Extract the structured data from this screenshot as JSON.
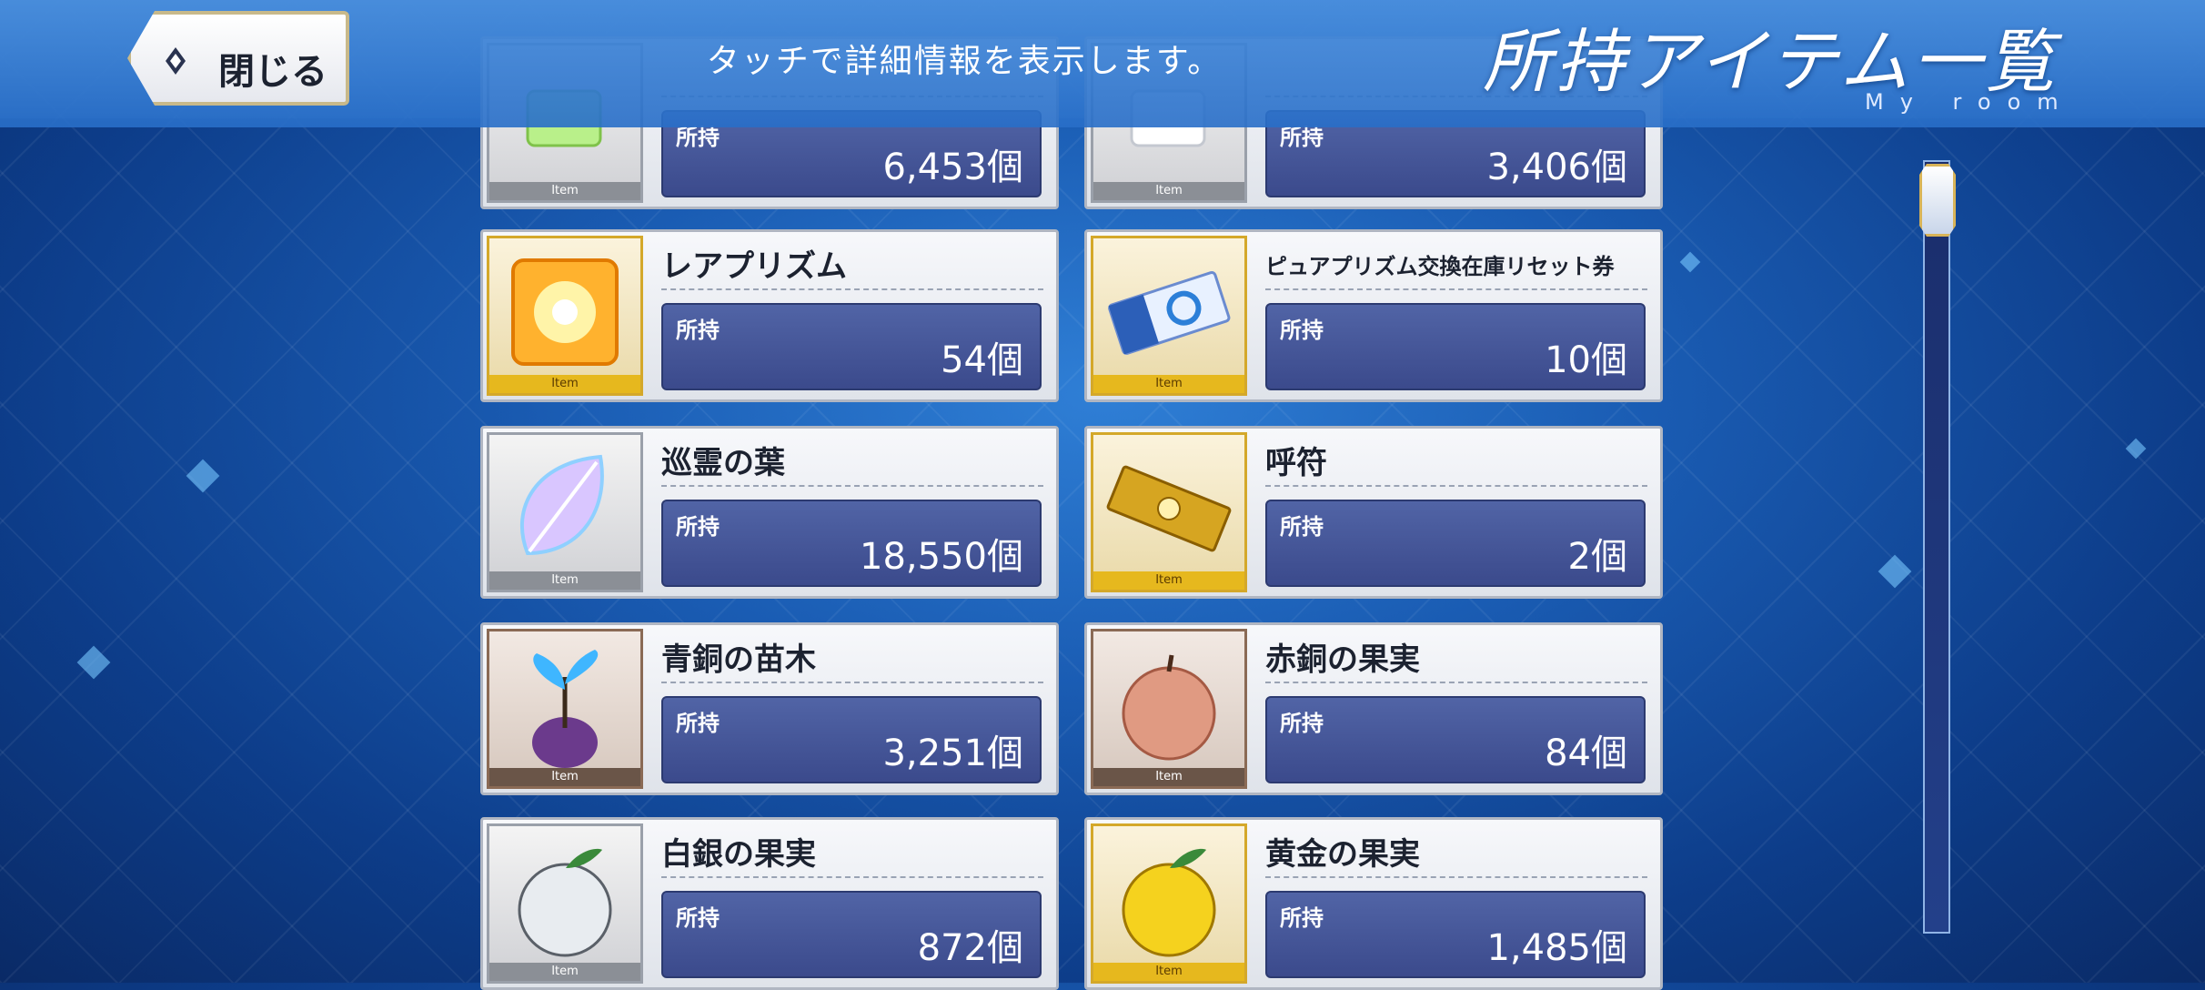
{
  "header": {
    "close_label": "閉じる",
    "hint": "タッチで詳細情報を表示します。",
    "title": "所持アイテム一覧",
    "subtitle": "My room"
  },
  "labels": {
    "owned": "所持",
    "tag": "Item"
  },
  "items": [
    {
      "name": "",
      "count": "6,453個",
      "rarity": "silver",
      "icon": "green-crystal-icon"
    },
    {
      "name": "",
      "count": "3,406個",
      "rarity": "silver",
      "icon": "white-crystal-icon"
    },
    {
      "name": "レアプリズム",
      "count": "54個",
      "rarity": "gold",
      "icon": "rare-prism-icon"
    },
    {
      "name": "ピュアプリズム交換在庫リセット券",
      "count": "10個",
      "rarity": "gold",
      "icon": "ticket-icon"
    },
    {
      "name": "巡霊の葉",
      "count": "18,550個",
      "rarity": "silver",
      "icon": "leaf-icon"
    },
    {
      "name": "呼符",
      "count": "2個",
      "rarity": "gold",
      "icon": "summon-ticket-icon"
    },
    {
      "name": "青銅の苗木",
      "count": "3,251個",
      "rarity": "bronze",
      "icon": "sapling-icon"
    },
    {
      "name": "赤銅の果実",
      "count": "84個",
      "rarity": "bronze",
      "icon": "copper-apple-icon"
    },
    {
      "name": "白銀の果実",
      "count": "872個",
      "rarity": "silver",
      "icon": "silver-apple-icon"
    },
    {
      "name": "黄金の果実",
      "count": "1,485個",
      "rarity": "gold",
      "icon": "gold-apple-icon"
    }
  ],
  "colors": {
    "gold": "#e6b81e",
    "silver": "#8b8f96",
    "bronze": "#6a5548",
    "count_bg": "#3b4a8c"
  }
}
